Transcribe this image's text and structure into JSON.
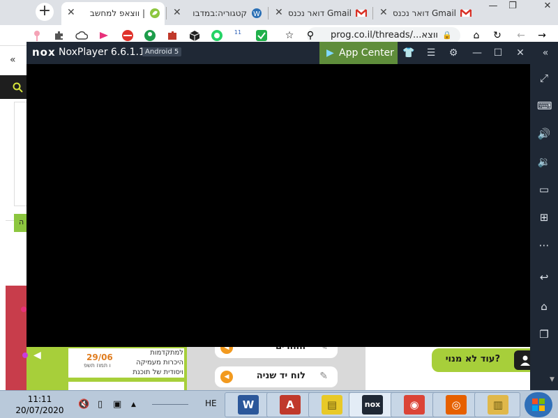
{
  "browser": {
    "new_tab_symbol": "+",
    "tabs": [
      {
        "label": "ווצאפ למחשב |",
        "favicon": "leaf-icon",
        "active": true
      },
      {
        "label": "קטגוריה:במדבו",
        "favicon": "wiki-icon",
        "active": false
      },
      {
        "label": "דואר נכנס Gmail",
        "favicon": "gmail-icon",
        "active": false
      },
      {
        "label": "דואר נכנס Gmail",
        "favicon": "gmail-icon",
        "active": false
      }
    ],
    "close_symbol": "✕",
    "window_controls": {
      "minimize": "—",
      "maximize": "❐",
      "close": "✕"
    },
    "url": "prog.co.il/threads/...ווצא",
    "nav_symbols": {
      "back": "←",
      "forward": "→",
      "reload": "↻",
      "home": "⌂",
      "star": "☆",
      "lock": "🔒",
      "search": "⚲"
    },
    "extension_badge": "11"
  },
  "nox": {
    "logo": "nox",
    "title": "NoxPlayer 6.6.1.1",
    "android": "Android 5",
    "app_center": "App Center",
    "title_buttons": [
      {
        "name": "skin-icon",
        "glyph": "👕"
      },
      {
        "name": "menu-icon",
        "glyph": "☰"
      },
      {
        "name": "settings-icon",
        "glyph": "⚙"
      },
      {
        "name": "minimize-icon",
        "glyph": "—"
      },
      {
        "name": "maximize-icon",
        "glyph": "☐"
      },
      {
        "name": "close-icon",
        "glyph": "✕"
      },
      {
        "name": "collapse-sidebar-icon",
        "glyph": "«"
      }
    ],
    "sidebar_buttons": [
      {
        "name": "fullscreen-icon",
        "glyph": "⤢"
      },
      {
        "name": "keyboard-icon",
        "glyph": "⌨"
      },
      {
        "name": "volume-up-icon",
        "glyph": "🔊"
      },
      {
        "name": "volume-down-icon",
        "glyph": "🔉"
      },
      {
        "name": "screen-icon",
        "glyph": "▭"
      },
      {
        "name": "apk-install-icon",
        "glyph": "⊞"
      },
      {
        "name": "more-icon",
        "glyph": "⋯"
      },
      {
        "name": "back-icon",
        "glyph": "↩"
      },
      {
        "name": "home-icon",
        "glyph": "⌂"
      },
      {
        "name": "recent-apps-icon",
        "glyph": "❐"
      }
    ]
  },
  "webpage": {
    "news": {
      "date": "29/06",
      "date_sub": "ו תמוז תשפ",
      "text_lines": [
        "למתקדמות",
        "היכרות מעמיקה",
        "ויסודית של תוכנת"
      ],
      "next_line": "..."
    },
    "pill_buttons": [
      {
        "label": "ההורים",
        "play": "◀",
        "edit": "✎"
      },
      {
        "label": "לוח יד שניה",
        "play": "◀",
        "edit": "✎"
      }
    ],
    "help_button": {
      "label": "עוד לא מנוי?",
      "icon": "user-icon"
    },
    "left_button_text": "ה"
  },
  "taskbar": {
    "time": "11:11",
    "date": "20/07/2020",
    "language": "HE",
    "apps": [
      {
        "name": "word-icon",
        "glyph": "W",
        "color": "#2b579a"
      },
      {
        "name": "acrobat-icon",
        "glyph": "A",
        "color": "#c0392b"
      },
      {
        "name": "sticky-notes-icon",
        "glyph": "▤",
        "color": "#e8c928"
      },
      {
        "name": "nox-app-icon",
        "glyph": "nox",
        "color": "#1f2835"
      },
      {
        "name": "chrome-icon",
        "glyph": "◉",
        "color": "#db4437"
      },
      {
        "name": "firefox-icon",
        "glyph": "◎",
        "color": "#e66000"
      },
      {
        "name": "explorer-icon",
        "glyph": "▥",
        "color": "#e0b84a"
      }
    ],
    "tray_icons": [
      {
        "name": "volume-muted-icon",
        "glyph": "🔇"
      },
      {
        "name": "battery-icon",
        "glyph": "▯"
      },
      {
        "name": "network-icon",
        "glyph": "▣"
      },
      {
        "name": "show-hidden-icon",
        "glyph": "▲"
      }
    ]
  }
}
